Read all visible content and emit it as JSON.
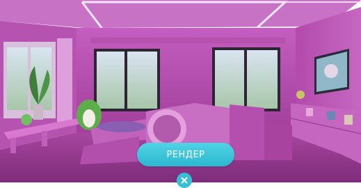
{
  "render_button": {
    "label": "РЕНДЕР"
  },
  "close_button": {
    "icon": "close-icon"
  },
  "colors": {
    "accent": "#38bfd6",
    "wall": "#a43f9d",
    "floor": "#9a3f97"
  }
}
